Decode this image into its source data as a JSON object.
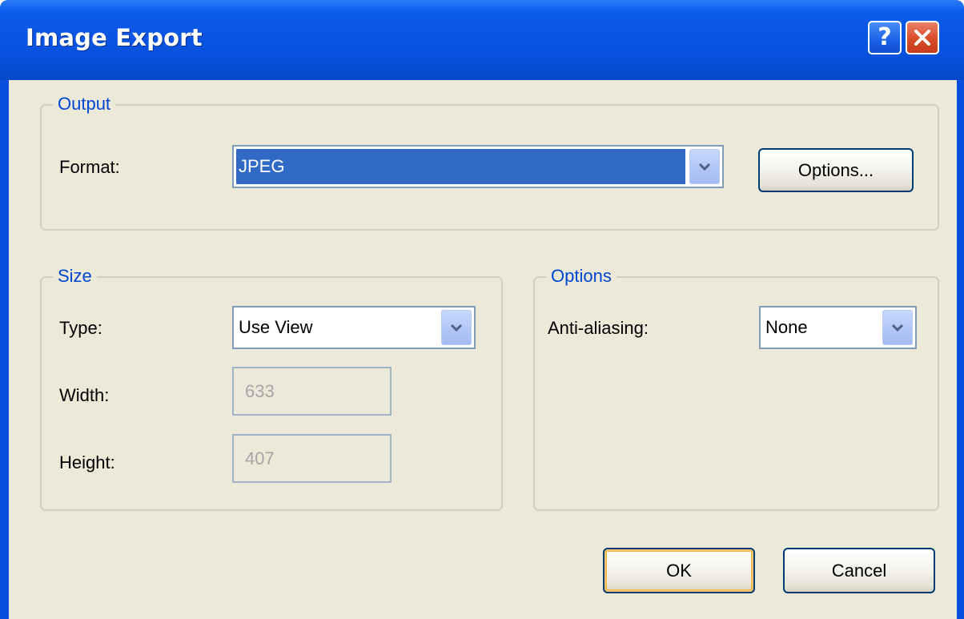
{
  "window": {
    "title": "Image Export",
    "help_glyph": "?",
    "accent": "#0a55e4"
  },
  "output_group": {
    "legend": "Output",
    "format_label": "Format:",
    "format_value": "JPEG",
    "options_button": "Options..."
  },
  "size_group": {
    "legend": "Size",
    "type_label": "Type:",
    "type_value": "Use View",
    "width_label": "Width:",
    "width_value": "633",
    "height_label": "Height:",
    "height_value": "407"
  },
  "options_group": {
    "legend": "Options",
    "antialiasing_label": "Anti-aliasing:",
    "antialiasing_value": "None"
  },
  "buttons": {
    "ok": "OK",
    "cancel": "Cancel"
  },
  "icons": {
    "help": "help-icon",
    "close": "close-icon",
    "dropdown": "chevron-down-icon"
  }
}
